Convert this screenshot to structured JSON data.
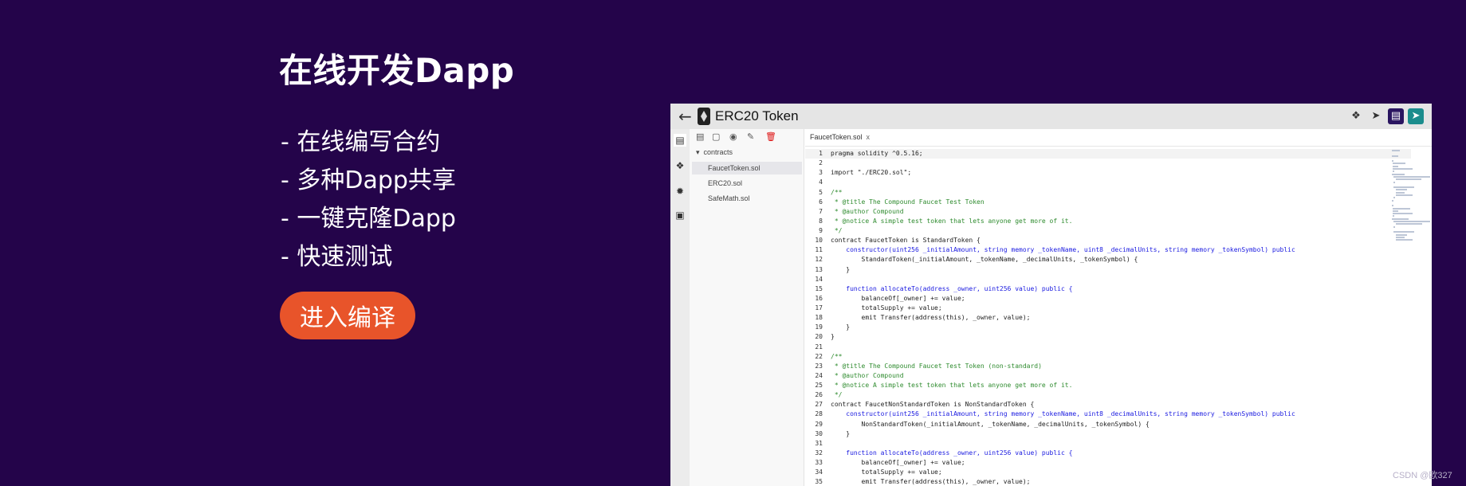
{
  "promo": {
    "title": "在线开发Dapp",
    "features": [
      "- 在线编写合约",
      "- 多种Dapp共享",
      "- 一键克隆Dapp",
      "- 快速测试"
    ],
    "button_label": "进入编译"
  },
  "ide": {
    "title": "ERC20 Token",
    "folder": "contracts",
    "files": [
      {
        "name": "FaucetToken.sol",
        "selected": true
      },
      {
        "name": "ERC20.sol",
        "selected": false
      },
      {
        "name": "SafeMath.sol",
        "selected": false
      }
    ],
    "active_tab": "FaucetToken.sol",
    "tab_close": "x",
    "code_lines": [
      "pragma solidity ^0.5.16;",
      "",
      "import \"./ERC20.sol\";",
      "",
      "/**",
      " * @title The Compound Faucet Test Token",
      " * @author Compound",
      " * @notice A simple test token that lets anyone get more of it.",
      " */",
      "contract FaucetToken is StandardToken {",
      "    constructor(uint256 _initialAmount, string memory _tokenName, uint8 _decimalUnits, string memory _tokenSymbol) public",
      "        StandardToken(_initialAmount, _tokenName, _decimalUnits, _tokenSymbol) {",
      "    }",
      "",
      "    function allocateTo(address _owner, uint256 value) public {",
      "        balanceOf[_owner] += value;",
      "        totalSupply += value;",
      "        emit Transfer(address(this), _owner, value);",
      "    }",
      "}",
      "",
      "/**",
      " * @title The Compound Faucet Test Token (non-standard)",
      " * @author Compound",
      " * @notice A simple test token that lets anyone get more of it.",
      " */",
      "contract FaucetNonStandardToken is NonStandardToken {",
      "    constructor(uint256 _initialAmount, string memory _tokenName, uint8 _decimalUnits, string memory _tokenSymbol) public",
      "        NonStandardToken(_initialAmount, _tokenName, _decimalUnits, _tokenSymbol) {",
      "    }",
      "",
      "    function allocateTo(address _owner, uint256 value) public {",
      "        balanceOf[_owner] += value;",
      "        totalSupply += value;",
      "        emit Transfer(address(this), _owner, value);"
    ]
  },
  "watermark": "CSDN @欧327",
  "colors": {
    "background": "#24044a",
    "button": "#e8542a",
    "comment": "#2e8b2e",
    "keyword": "#1a1ae0"
  },
  "icons": {
    "back": "arrow-left-icon",
    "logo": "ethereum-logo-icon",
    "header": [
      "compass-icon",
      "rocket-icon",
      "document-icon",
      "send-icon"
    ],
    "rail": [
      "file-explorer-icon",
      "compiler-icon",
      "debugger-icon",
      "deploy-icon"
    ],
    "toolbar": [
      "new-file-icon",
      "new-folder-icon",
      "github-icon",
      "edit-icon",
      "trash-icon"
    ]
  }
}
